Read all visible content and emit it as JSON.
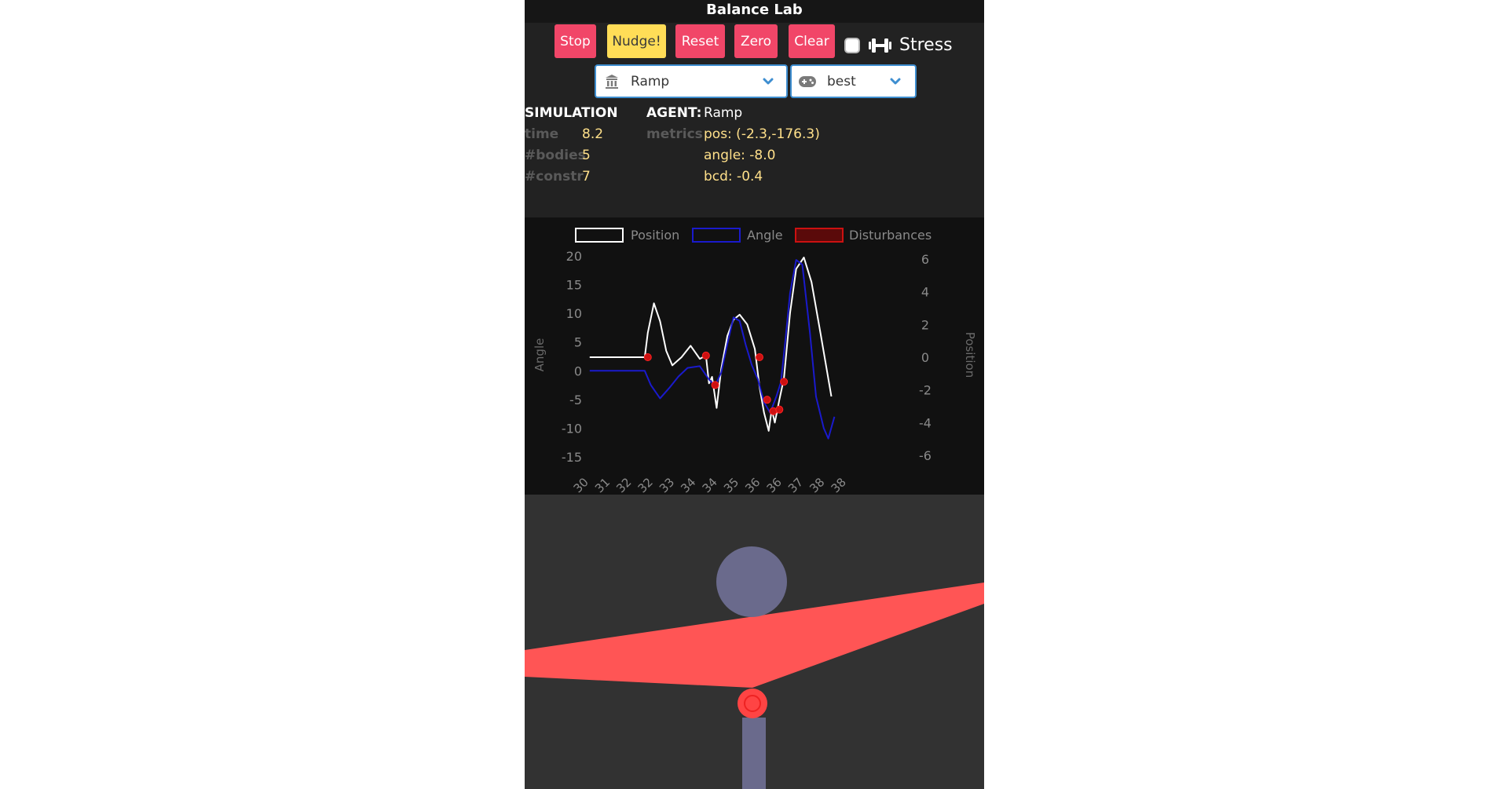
{
  "app": {
    "title": "Balance Lab"
  },
  "toolbar": {
    "stop_label": "Stop",
    "nudge_label": "Nudge!",
    "reset_label": "Reset",
    "zero_label": "Zero",
    "clear_label": "Clear",
    "stress_label": "Stress",
    "stress_checked": false
  },
  "selects": {
    "environment": {
      "value": "Ramp",
      "icon": "building-icon"
    },
    "agent": {
      "value": "best",
      "icon": "gamepad-icon"
    }
  },
  "simulation": {
    "header": "SIMULATION",
    "time_label": "time",
    "time_value": "8.2",
    "bodies_label": "#bodies",
    "bodies_value": "5",
    "constr_label": "#constr",
    "constr_value": "7"
  },
  "agent": {
    "header": "AGENT:",
    "name": "Ramp",
    "metrics_label": "metrics",
    "pos": "pos: (-2.3,-176.3)",
    "angle": "angle: -8.0",
    "bcd": "bcd: -0.4"
  },
  "colors": {
    "button_danger": "#f14668",
    "button_warning": "#ffdd57",
    "select_border": "#3e8ed0",
    "position_line": "#ffffff",
    "angle_line": "#1a1acc",
    "disturbance": "#cc1111",
    "ramp": "#ff5555",
    "ball": "#6a6a8c",
    "pivot": "#ff4444"
  },
  "chart_data": {
    "type": "line",
    "legend": [
      "Position",
      "Angle",
      "Disturbances"
    ],
    "legend_placement": "top",
    "x_ticks": [
      "30",
      "31",
      "32",
      "32",
      "33",
      "34",
      "34",
      "35",
      "36",
      "36",
      "37",
      "38",
      "38"
    ],
    "y_left_label": "Angle",
    "y_left_ticks": [
      "20",
      "15",
      "10",
      "5",
      "0",
      "-5",
      "-10",
      "-15"
    ],
    "y_left_range": [
      -15,
      20
    ],
    "y_right_label": "Position",
    "y_right_ticks": [
      "6",
      "4",
      "2",
      "0",
      "-2",
      "-4",
      "-6"
    ],
    "y_right_range": [
      -6,
      6
    ],
    "x_range": [
      30,
      38.6
    ],
    "grid": false,
    "series": [
      {
        "name": "Position",
        "axis": "right",
        "points": [
          [
            30.2,
            0
          ],
          [
            32.0,
            0
          ],
          [
            32.1,
            1.5
          ],
          [
            32.3,
            3.3
          ],
          [
            32.5,
            2.2
          ],
          [
            32.7,
            0.4
          ],
          [
            32.9,
            -0.5
          ],
          [
            33.2,
            0.0
          ],
          [
            33.5,
            0.7
          ],
          [
            33.8,
            -0.1
          ],
          [
            34.0,
            0.1
          ],
          [
            34.1,
            -1.6
          ],
          [
            34.2,
            -1.2
          ],
          [
            34.35,
            -3.1
          ],
          [
            34.5,
            -0.7
          ],
          [
            34.7,
            1.3
          ],
          [
            34.9,
            2.3
          ],
          [
            35.1,
            2.6
          ],
          [
            35.35,
            2.0
          ],
          [
            35.6,
            0.5
          ],
          [
            35.75,
            -1.8
          ],
          [
            35.9,
            -3.4
          ],
          [
            36.05,
            -4.5
          ],
          [
            36.15,
            -3.2
          ],
          [
            36.25,
            -4.0
          ],
          [
            36.4,
            -2.6
          ],
          [
            36.55,
            -1.3
          ],
          [
            36.75,
            2.7
          ],
          [
            36.95,
            5.4
          ],
          [
            37.2,
            6.1
          ],
          [
            37.45,
            4.6
          ],
          [
            37.75,
            1.4
          ],
          [
            38.1,
            -2.4
          ]
        ]
      },
      {
        "name": "Angle",
        "axis": "left",
        "points": [
          [
            30.2,
            0
          ],
          [
            32.0,
            0
          ],
          [
            32.2,
            -2.5
          ],
          [
            32.5,
            -4.8
          ],
          [
            32.8,
            -3.0
          ],
          [
            33.1,
            -1.0
          ],
          [
            33.4,
            0.5
          ],
          [
            33.8,
            0.8
          ],
          [
            34.1,
            -1.5
          ],
          [
            34.3,
            -2.6
          ],
          [
            34.5,
            -0.3
          ],
          [
            34.7,
            4.7
          ],
          [
            34.9,
            9.3
          ],
          [
            35.1,
            8.7
          ],
          [
            35.3,
            4.5
          ],
          [
            35.5,
            1.0
          ],
          [
            35.7,
            -1.5
          ],
          [
            35.9,
            -5.5
          ],
          [
            36.1,
            -7.3
          ],
          [
            36.3,
            -4.5
          ],
          [
            36.45,
            -2.0
          ],
          [
            36.6,
            5.5
          ],
          [
            36.75,
            13.5
          ],
          [
            36.95,
            19.3
          ],
          [
            37.15,
            18.5
          ],
          [
            37.4,
            6.5
          ],
          [
            37.6,
            -4.5
          ],
          [
            37.85,
            -10.0
          ],
          [
            38.0,
            -11.8
          ],
          [
            38.2,
            -8.0
          ]
        ]
      }
    ],
    "disturbances": [
      [
        32.1,
        0
      ],
      [
        34.0,
        0.1
      ],
      [
        34.3,
        -1.7
      ],
      [
        35.75,
        0
      ],
      [
        36.0,
        -2.6
      ],
      [
        36.2,
        -3.3
      ],
      [
        36.4,
        -3.2
      ],
      [
        36.55,
        -1.5
      ]
    ]
  }
}
